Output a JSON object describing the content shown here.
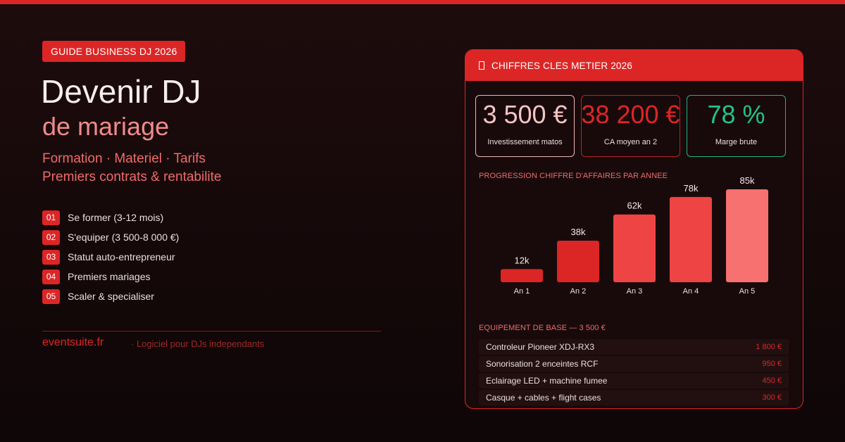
{
  "badge": "GUIDE BUSINESS DJ 2026",
  "title": "Devenir DJ",
  "subtitle": "de mariage",
  "tagline1": "Formation · Materiel · Tarifs",
  "tagline2": "Premiers contrats & rentabilite",
  "steps": [
    {
      "num": "01",
      "label": "Se former (3-12 mois)"
    },
    {
      "num": "02",
      "label": "S'equiper (3 500-8 000 €)"
    },
    {
      "num": "03",
      "label": "Statut auto-entrepreneur"
    },
    {
      "num": "04",
      "label": "Premiers mariages"
    },
    {
      "num": "05",
      "label": "Scaler & specialiser"
    }
  ],
  "footer": {
    "site": "eventsuite.fr",
    "tag": "· Logiciel pour DJs independants"
  },
  "panel": {
    "header": "CHIFFRES CLES METIER 2026",
    "header_icon": "bar-chart-icon",
    "kpis": [
      {
        "value": "3 500 €",
        "label": "Investissement matos"
      },
      {
        "value": "38 200 €",
        "label": "CA moyen an 2"
      },
      {
        "value": "78 %",
        "label": "Marge brute"
      }
    ],
    "colors": {
      "accent": "#dc2626",
      "green": "#22c28b"
    },
    "chart_title": "PROGRESSION CHIFFRE D'AFFAIRES PAR ANNEE",
    "equip_title": "EQUIPEMENT DE BASE — 3 500 €",
    "equipment": [
      {
        "name": "Controleur Pioneer XDJ-RX3",
        "price": "1 800 €"
      },
      {
        "name": "Sonorisation 2 enceintes RCF",
        "price": "950 €"
      },
      {
        "name": "Eclairage LED + machine fumee",
        "price": "450 €"
      },
      {
        "name": "Casque + cables + flight cases",
        "price": "300 €"
      }
    ]
  },
  "chart_data": {
    "type": "bar",
    "title": "PROGRESSION CHIFFRE D'AFFAIRES PAR ANNEE",
    "categories": [
      "An 1",
      "An 2",
      "An 3",
      "An 4",
      "An 5"
    ],
    "values": [
      12,
      38,
      62,
      78,
      85
    ],
    "labels": [
      "12k",
      "38k",
      "62k",
      "78k",
      "85k"
    ],
    "colors": [
      "#dc2626",
      "#dc2626",
      "#ef4444",
      "#ef4444",
      "#f87171"
    ]
  }
}
